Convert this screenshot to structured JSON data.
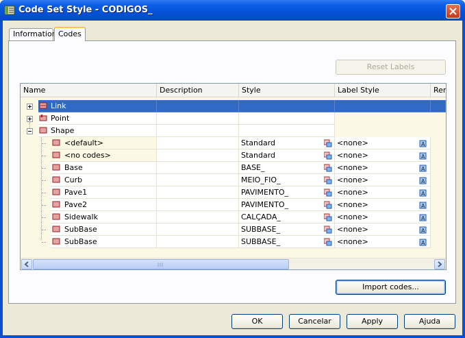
{
  "window": {
    "title": "Code Set Style - CODIGOS_"
  },
  "tabs": [
    {
      "label": "Information",
      "active": false
    },
    {
      "label": "Codes",
      "active": true
    }
  ],
  "reset_labels_button": "Reset Labels",
  "grid": {
    "columns": [
      "Name",
      "Description",
      "Style",
      "Label Style",
      "Rer"
    ],
    "rows": [
      {
        "name": "Link",
        "style": "",
        "label_style": "",
        "level": 0,
        "expander": "+",
        "selected": true
      },
      {
        "name": "Point",
        "style": "",
        "label_style": "",
        "level": 0,
        "expander": "+",
        "selected": false
      },
      {
        "name": "Shape",
        "style": "",
        "label_style": "",
        "level": 0,
        "expander": "-",
        "selected": false
      },
      {
        "name": "<default>",
        "style": "Standard",
        "label_style": "<none>",
        "level": 1
      },
      {
        "name": "<no codes>",
        "style": "Standard",
        "label_style": "<none>",
        "level": 1
      },
      {
        "name": "Base",
        "style": "BASE_",
        "label_style": "<none>",
        "level": 1
      },
      {
        "name": "Curb",
        "style": "MEIO_FIO_",
        "label_style": "<none>",
        "level": 1
      },
      {
        "name": "Pave1",
        "style": "PAVIMENTO_",
        "label_style": "<none>",
        "level": 1
      },
      {
        "name": "Pave2",
        "style": "PAVIMENTO_",
        "label_style": "<none>",
        "level": 1
      },
      {
        "name": "Sidewalk",
        "style": "CALÇADA_",
        "label_style": "<none>",
        "level": 1
      },
      {
        "name": "SubBase",
        "style": "SUBBASE_",
        "label_style": "<none>",
        "level": 1
      },
      {
        "name": "SubBase",
        "style": "SUBBASE_",
        "label_style": "<none>",
        "level": 1
      }
    ]
  },
  "import_codes_button": "Import codes...",
  "footer": {
    "ok": "OK",
    "cancel": "Cancelar",
    "apply": "Apply",
    "help": "Ajuda"
  },
  "colors": {
    "title_bar": "#0552d8",
    "selection": "#316ac5",
    "panel": "#ece9d8"
  }
}
